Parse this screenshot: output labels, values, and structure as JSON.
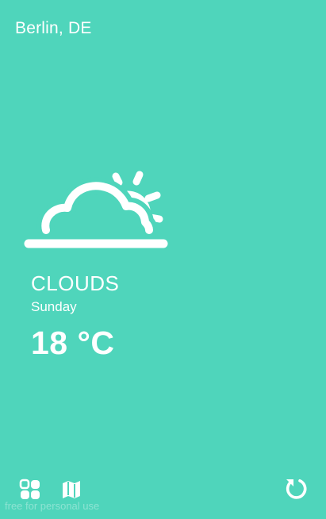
{
  "header": {
    "location": "Berlin, DE"
  },
  "weather": {
    "icon": "cloud-sun-icon",
    "condition": "CLOUDS",
    "day": "Sunday",
    "temperature": "18 °C"
  },
  "toolbar": {
    "grid_icon": "grid-icon",
    "map_icon": "map-icon",
    "refresh_icon": "refresh-icon"
  },
  "footer": {
    "watermark": "free for personal use"
  },
  "colors": {
    "background": "#4fd5bb",
    "foreground": "#ffffff"
  }
}
